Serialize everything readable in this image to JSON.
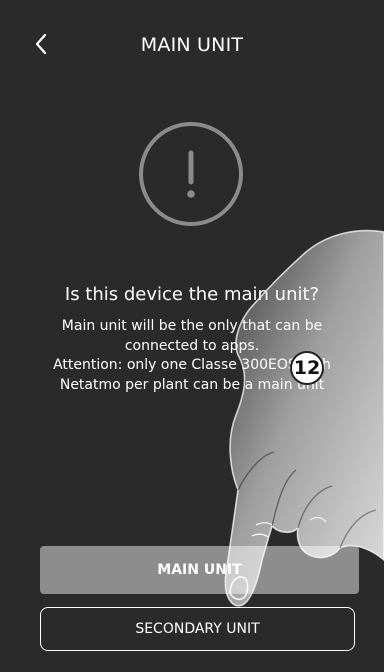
{
  "header": {
    "title": "MAIN UNIT",
    "back_icon": "chevron-left-icon"
  },
  "alert": {
    "icon": "exclamation-circle-icon"
  },
  "content": {
    "question": "Is this device the main unit?",
    "message_line1": "Main unit will be the only that can be",
    "message_line2": "connected to apps.",
    "attention_line1": "Attention: only one Classe 300EOS with",
    "attention_line2": "Netatmo per plant can be a main unit"
  },
  "buttons": {
    "main_unit_label": "MAIN UNIT",
    "secondary_unit_label": "SECONDARY UNIT"
  },
  "annotation": {
    "step_number": "12"
  },
  "colors": {
    "background": "#2a2a2a",
    "main_button": "#8d8d8d",
    "text": "#ffffff"
  }
}
